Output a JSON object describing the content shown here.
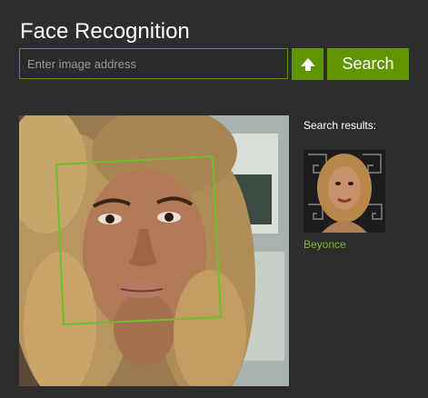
{
  "header": {
    "title": "Face Recognition"
  },
  "search": {
    "placeholder": "Enter image address",
    "value": "",
    "button_label": "Search",
    "upload_icon": "upload-arrow-icon"
  },
  "colors": {
    "background": "#2d2d2d",
    "accent": "#5f9600",
    "link": "#7db533",
    "face_box": "#6fbf2a"
  },
  "results": {
    "label": "Search results:",
    "items": [
      {
        "name": "Beyonce"
      }
    ]
  }
}
